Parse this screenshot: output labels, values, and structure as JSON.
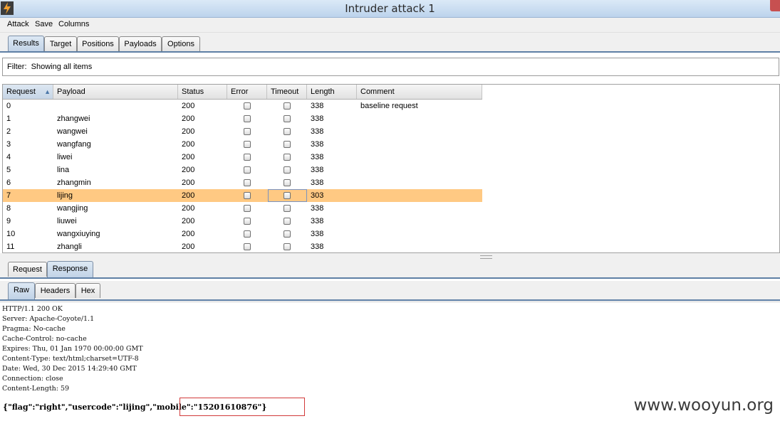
{
  "window": {
    "title": "Intruder attack 1"
  },
  "menu": [
    "Attack",
    "Save",
    "Columns"
  ],
  "main_tabs": [
    {
      "label": "Results",
      "active": true
    },
    {
      "label": "Target",
      "active": false
    },
    {
      "label": "Positions",
      "active": false
    },
    {
      "label": "Payloads",
      "active": false
    },
    {
      "label": "Options",
      "active": false
    }
  ],
  "filter": {
    "label": "Filter:",
    "value": "Showing all items"
  },
  "table": {
    "columns": [
      "Request",
      "Payload",
      "Status",
      "Error",
      "Timeout",
      "Length",
      "Comment"
    ],
    "sorted_column": "Request",
    "rows": [
      {
        "request": "0",
        "payload": "",
        "status": "200",
        "error": false,
        "timeout": false,
        "length": "338",
        "comment": "baseline request"
      },
      {
        "request": "1",
        "payload": "zhangwei",
        "status": "200",
        "error": false,
        "timeout": false,
        "length": "338",
        "comment": ""
      },
      {
        "request": "2",
        "payload": "wangwei",
        "status": "200",
        "error": false,
        "timeout": false,
        "length": "338",
        "comment": ""
      },
      {
        "request": "3",
        "payload": "wangfang",
        "status": "200",
        "error": false,
        "timeout": false,
        "length": "338",
        "comment": ""
      },
      {
        "request": "4",
        "payload": "liwei",
        "status": "200",
        "error": false,
        "timeout": false,
        "length": "338",
        "comment": ""
      },
      {
        "request": "5",
        "payload": "lina",
        "status": "200",
        "error": false,
        "timeout": false,
        "length": "338",
        "comment": ""
      },
      {
        "request": "6",
        "payload": "zhangmin",
        "status": "200",
        "error": false,
        "timeout": false,
        "length": "338",
        "comment": ""
      },
      {
        "request": "7",
        "payload": "lijing",
        "status": "200",
        "error": false,
        "timeout": false,
        "length": "303",
        "comment": "",
        "selected": true
      },
      {
        "request": "8",
        "payload": "wangjing",
        "status": "200",
        "error": false,
        "timeout": false,
        "length": "338",
        "comment": ""
      },
      {
        "request": "9",
        "payload": "liuwei",
        "status": "200",
        "error": false,
        "timeout": false,
        "length": "338",
        "comment": ""
      },
      {
        "request": "10",
        "payload": "wangxiuying",
        "status": "200",
        "error": false,
        "timeout": false,
        "length": "338",
        "comment": ""
      },
      {
        "request": "11",
        "payload": "zhangli",
        "status": "200",
        "error": false,
        "timeout": false,
        "length": "338",
        "comment": ""
      }
    ]
  },
  "detail_tabs": [
    {
      "label": "Request",
      "active": false
    },
    {
      "label": "Response",
      "active": true
    }
  ],
  "view_tabs": [
    {
      "label": "Raw",
      "active": true
    },
    {
      "label": "Headers",
      "active": false
    },
    {
      "label": "Hex",
      "active": false
    }
  ],
  "response": {
    "headers": [
      "HTTP/1.1 200 OK",
      "Server: Apache-Coyote/1.1",
      "Pragma: No-cache",
      "Cache-Control: no-cache",
      "Expires: Thu, 01 Jan 1970 00:00:00 GMT",
      "Content-Type: text/html;charset=UTF-8",
      "Date: Wed, 30 Dec 2015 14:29:40 GMT",
      "Connection: close",
      "Content-Length: 59"
    ],
    "body": "{\"flag\":\"right\",\"usercode\":\"lijing\",\"mobile\":\"15201610876\"}"
  },
  "watermark": "www.wooyun.org",
  "colors": {
    "selected_row": "#ffc983",
    "highlight_box": "#d23a3a",
    "tab_underline": "#5e7fa5"
  }
}
